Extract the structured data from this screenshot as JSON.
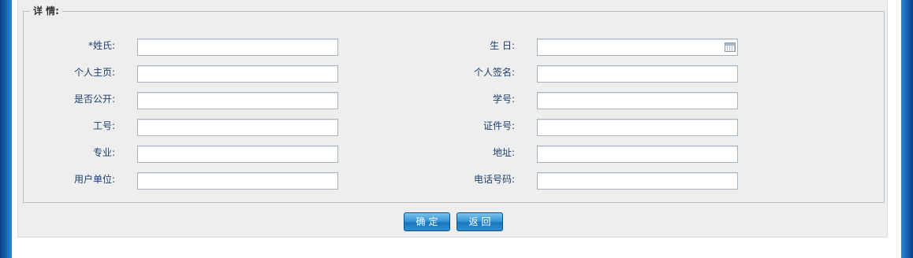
{
  "form": {
    "legend": "详 情:",
    "fields_left": [
      {
        "label": "*姓氏:",
        "value": "",
        "placeholder": ""
      },
      {
        "label": "个人主页:",
        "value": "",
        "placeholder": ""
      },
      {
        "label": "是否公开:",
        "value": "",
        "placeholder": ""
      },
      {
        "label": "工号:",
        "value": "",
        "placeholder": ""
      },
      {
        "label": "专业:",
        "value": "",
        "placeholder": ""
      },
      {
        "label": "用户单位:",
        "value": "",
        "placeholder": ""
      }
    ],
    "fields_right": [
      {
        "label": "生 日:",
        "value": "",
        "placeholder": ""
      },
      {
        "label": "个人签名:",
        "value": "",
        "placeholder": ""
      },
      {
        "label": "学号:",
        "value": "",
        "placeholder": ""
      },
      {
        "label": "证件号:",
        "value": "",
        "placeholder": ""
      },
      {
        "label": "地址:",
        "value": "",
        "placeholder": ""
      },
      {
        "label": "电话号码:",
        "value": "",
        "placeholder": ""
      }
    ],
    "calendar_icon": "calendar-icon"
  },
  "buttons": {
    "confirm_label": "确定",
    "back_label": "返回"
  },
  "colors": {
    "frame_blue": "#1766b8",
    "panel_bg": "#eeeeee",
    "label_color": "#1c3f6e",
    "button_blue": "#2f8fd2"
  }
}
